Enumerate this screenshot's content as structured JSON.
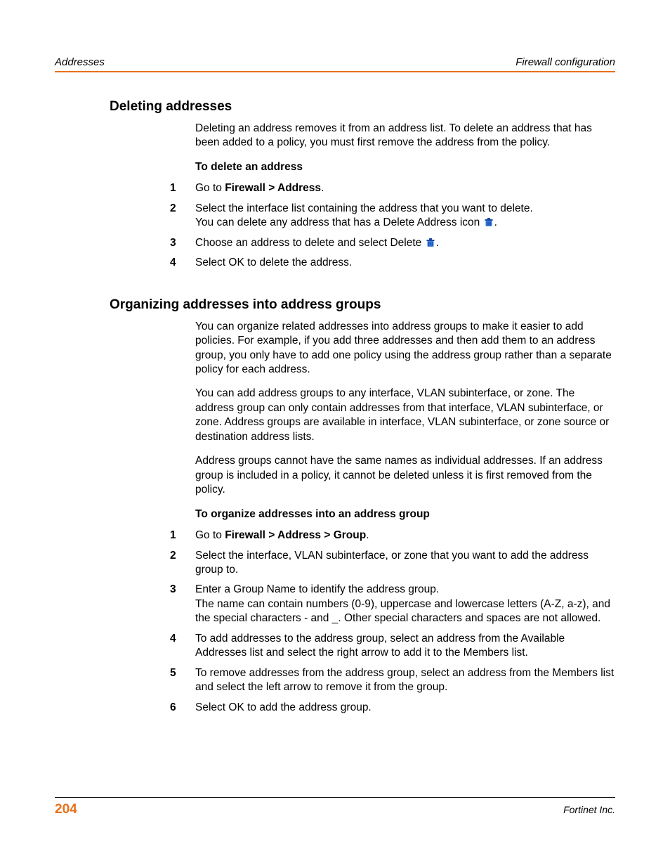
{
  "header": {
    "left": "Addresses",
    "right": "Firewall configuration"
  },
  "sections": [
    {
      "heading": "Deleting addresses",
      "intro": [
        "Deleting an address removes it from an address list. To delete an address that has been added to a policy, you must first remove the address from the policy."
      ],
      "procedure_title": "To delete an address",
      "steps": [
        {
          "n": "1",
          "prefix": "Go to ",
          "bold": "Firewall > Address",
          "suffix": "."
        },
        {
          "n": "2",
          "line1": "Select the interface list containing the address that you want to delete.",
          "line2_before": "You can delete any address that has a Delete Address icon ",
          "line2_after": "."
        },
        {
          "n": "3",
          "line1_before": "Choose an address to delete and select Delete ",
          "line1_after": "."
        },
        {
          "n": "4",
          "plain": "Select OK to delete the address."
        }
      ]
    },
    {
      "heading": "Organizing addresses into address groups",
      "intro": [
        "You can organize related addresses into address groups to make it easier to add policies. For example, if you add three addresses and then add them to an address group, you only have to add one policy using the address group rather than a separate policy for each address.",
        "You can add address groups to any interface, VLAN subinterface, or zone. The address group can only contain addresses from that interface, VLAN subinterface, or zone. Address groups are available in interface, VLAN subinterface, or zone source or destination address lists.",
        "Address groups cannot have the same names as individual addresses. If an address group is included in a policy, it cannot be deleted unless it is first removed from the policy."
      ],
      "procedure_title": "To organize addresses into an address group",
      "steps": [
        {
          "n": "1",
          "prefix": "Go to ",
          "bold": "Firewall > Address > Group",
          "suffix": "."
        },
        {
          "n": "2",
          "plain": "Select the interface, VLAN subinterface, or zone that you want to add the address group to."
        },
        {
          "n": "3",
          "line1": "Enter a Group Name to identify the address group.",
          "line2": "The name can contain numbers (0-9), uppercase and lowercase letters (A-Z, a-z), and the special characters - and _. Other special characters and spaces are not allowed."
        },
        {
          "n": "4",
          "plain": "To add addresses to the address group, select an address from the Available Addresses list and select the right arrow to add it to the Members list."
        },
        {
          "n": "5",
          "plain": "To remove addresses from the address group, select an address from the Members list and select the left arrow to remove it from the group."
        },
        {
          "n": "6",
          "plain": "Select OK to add the address group."
        }
      ]
    }
  ],
  "footer": {
    "page": "204",
    "brand": "Fortinet Inc."
  },
  "icons": {
    "trash": "trash-icon"
  }
}
